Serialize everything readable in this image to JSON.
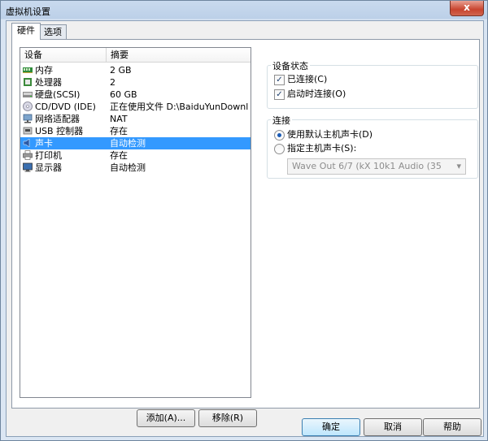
{
  "window": {
    "title": "虚拟机设置",
    "close_label": "x"
  },
  "tabs": [
    {
      "label": "硬件",
      "active": true
    },
    {
      "label": "选项",
      "active": false
    }
  ],
  "device_list": {
    "columns": [
      "设备",
      "摘要"
    ],
    "rows": [
      {
        "name": "内存",
        "summary": "2 GB",
        "icon": "memory-icon"
      },
      {
        "name": "处理器",
        "summary": "2",
        "icon": "processor-icon"
      },
      {
        "name": "硬盘(SCSI)",
        "summary": "60 GB",
        "icon": "hard-disk-icon"
      },
      {
        "name": "CD/DVD (IDE)",
        "summary": "正在使用文件 D:\\BaiduYunDownloa...",
        "icon": "cd-dvd-icon"
      },
      {
        "name": "网络适配器",
        "summary": "NAT",
        "icon": "network-adapter-icon"
      },
      {
        "name": "USB 控制器",
        "summary": "存在",
        "icon": "usb-controller-icon"
      },
      {
        "name": "声卡",
        "summary": "自动检测",
        "icon": "sound-card-icon",
        "selected": true
      },
      {
        "name": "打印机",
        "summary": "存在",
        "icon": "printer-icon"
      },
      {
        "name": "显示器",
        "summary": "自动检测",
        "icon": "display-icon"
      }
    ]
  },
  "list_buttons": {
    "add": "添加(A)...",
    "remove": "移除(R)"
  },
  "device_status": {
    "title": "设备状态",
    "connected": {
      "label": "已连接(C)",
      "checked": true
    },
    "connect_on_power": {
      "label": "启动时连接(O)",
      "checked": true
    }
  },
  "connection": {
    "title": "连接",
    "use_default": {
      "label": "使用默认主机声卡(D)",
      "selected": true
    },
    "specify": {
      "label": "指定主机声卡(S):",
      "selected": false
    },
    "sound_card_select": {
      "value": "Wave Out 6/7 (kX 10k1 Audio (35"
    }
  },
  "footer_buttons": {
    "ok": "确定",
    "cancel": "取消",
    "help": "帮助"
  },
  "colors": {
    "selection": "#3399ff",
    "title_bar": "#c9daee",
    "close_button": "#c8442e"
  }
}
